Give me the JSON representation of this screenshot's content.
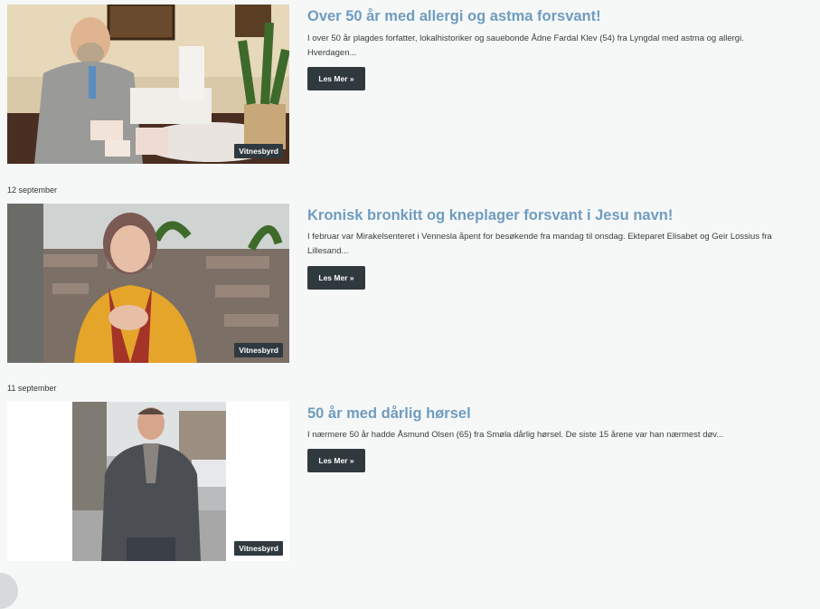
{
  "articles": [
    {
      "date": "",
      "title": "Over 50 år med allergi og astma forsvant!",
      "excerpt": "I over 50 år plagdes forfatter, lokalhistoriker og sauebonde Ådne Fardal Klev (54) fra Lyngdal med astma og allergi. Hverdagen...",
      "button": "Les Mer »",
      "category": "Vitnesbyrd"
    },
    {
      "date": "12 september",
      "title": "Kronisk bronkitt og kneplager forsvant i Jesu navn!",
      "excerpt": "I februar var Mirakelsenteret i Vennesla åpent for besøkende fra mandag til onsdag. Ekteparet Elisabet og Geir Lossius fra Lillesand...",
      "button": "Les Mer »",
      "category": "Vitnesbyrd"
    },
    {
      "date": "11 september",
      "title": "50 år med dårlig hørsel",
      "excerpt": "I nærmere 50 år hadde Åsmund Olsen (65) fra Smøla dårlig hørsel. De siste 15 årene var han nærmest døv...",
      "button": "Les Mer »",
      "category": "Vitnesbyrd"
    }
  ],
  "colors": {
    "title": "#6f9cbf",
    "button_bg": "#30393e",
    "badge_bg": "#2f3a40",
    "page_bg": "#f6f8f8"
  }
}
